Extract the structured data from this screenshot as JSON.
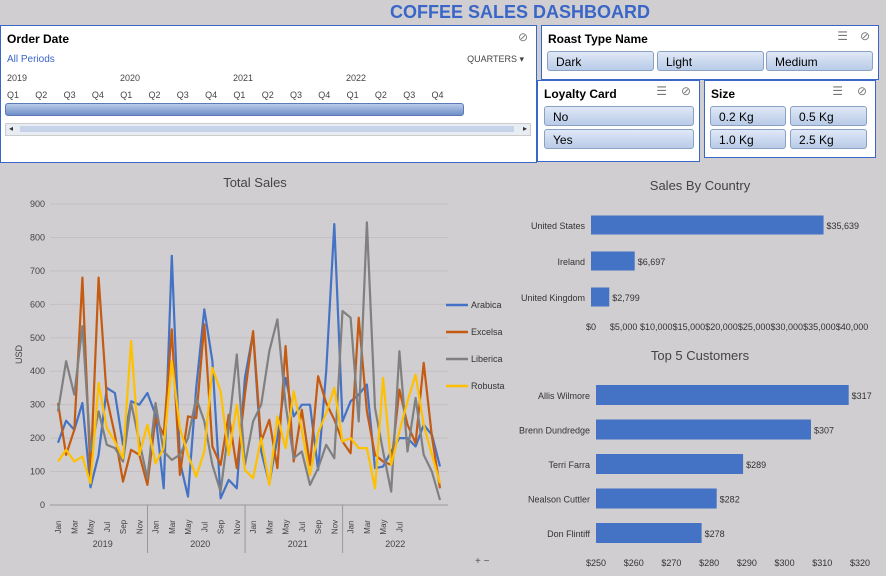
{
  "dashboard_title": "COFFEE SALES DASHBOARD",
  "order_date": {
    "header": "Order Date",
    "all_periods": "All Periods",
    "granularity": "QUARTERS",
    "years": [
      "2019",
      "2020",
      "2021",
      "2022"
    ],
    "quarters": [
      "Q1",
      "Q2",
      "Q3",
      "Q4",
      "Q1",
      "Q2",
      "Q3",
      "Q4",
      "Q1",
      "Q2",
      "Q3",
      "Q4",
      "Q1",
      "Q2",
      "Q3",
      "Q4"
    ]
  },
  "roast": {
    "header": "Roast Type Name",
    "items": [
      "Dark",
      "Light",
      "Medium"
    ]
  },
  "loyalty": {
    "header": "Loyalty Card",
    "items": [
      "No",
      "Yes"
    ]
  },
  "size": {
    "header": "Size",
    "items": [
      "0.2 Kg",
      "0.5 Kg",
      "1.0 Kg",
      "2.5 Kg"
    ]
  },
  "colors": {
    "accent": "#3a66c8",
    "arabica": "#4472c4",
    "excelsa": "#c55a11",
    "liberica": "#808080",
    "robusta": "#ffc000",
    "bar": "#4472c4"
  },
  "chart_data": [
    {
      "type": "line",
      "title": "Total Sales",
      "ylabel": "USD",
      "ylim": [
        0,
        900
      ],
      "yticks": [
        0,
        100,
        200,
        300,
        400,
        500,
        600,
        700,
        800,
        900
      ],
      "xtick_labels": [
        "Jan",
        "Mar",
        "May",
        "Jul",
        "Sep",
        "Nov",
        "Jan",
        "Mar",
        "May",
        "Jul",
        "Sep",
        "Nov",
        "Jan",
        "Mar",
        "May",
        "Jul",
        "Sep",
        "Nov",
        "Jan",
        "Mar",
        "May",
        "Jul"
      ],
      "year_labels": [
        "2019",
        "2020",
        "2021",
        "2022"
      ],
      "series": [
        {
          "name": "Arabica",
          "values": [
            186,
            252,
            225,
            305,
            53,
            150,
            350,
            335,
            180,
            310,
            300,
            335,
            270,
            50,
            745,
            130,
            25,
            350,
            585,
            430,
            20,
            75,
            50,
            380,
            515,
            160,
            65,
            200,
            380,
            265,
            300,
            300,
            105,
            400,
            840,
            250,
            310,
            330,
            360,
            110,
            115,
            160,
            200,
            200,
            175,
            240,
            210,
            115
          ]
        },
        {
          "name": "Excelsa",
          "values": [
            305,
            150,
            225,
            680,
            90,
            680,
            320,
            210,
            70,
            165,
            150,
            60,
            260,
            210,
            525,
            90,
            265,
            260,
            540,
            175,
            120,
            270,
            110,
            330,
            520,
            190,
            255,
            110,
            475,
            130,
            285,
            120,
            385,
            305,
            255,
            190,
            155,
            560,
            280,
            150,
            130,
            120,
            345,
            240,
            185,
            425,
            205,
            50
          ]
        },
        {
          "name": "Liberica",
          "values": [
            280,
            430,
            330,
            535,
            160,
            280,
            180,
            170,
            130,
            305,
            190,
            80,
            305,
            160,
            135,
            150,
            200,
            320,
            250,
            120,
            40,
            230,
            450,
            120,
            250,
            300,
            460,
            555,
            300,
            140,
            160,
            60,
            110,
            180,
            140,
            580,
            560,
            250,
            845,
            290,
            160,
            40,
            460,
            160,
            320,
            150,
            100,
            15
          ]
        },
        {
          "name": "Robusta",
          "values": [
            130,
            165,
            130,
            145,
            65,
            365,
            230,
            190,
            140,
            490,
            150,
            240,
            125,
            170,
            430,
            230,
            150,
            85,
            160,
            410,
            340,
            150,
            300,
            105,
            80,
            200,
            60,
            265,
            170,
            340,
            225,
            90,
            215,
            275,
            350,
            190,
            200,
            170,
            170,
            50,
            380,
            120,
            220,
            310,
            390,
            240,
            150,
            65
          ]
        }
      ]
    },
    {
      "type": "bar",
      "title": "Sales By Country",
      "categories": [
        "United States",
        "Ireland",
        "United Kingdom"
      ],
      "values": [
        35639,
        6697,
        2799
      ],
      "value_labels": [
        "$35,639",
        "$6,697",
        "$2,799"
      ],
      "xlim": [
        0,
        40000
      ],
      "xtick_labels": [
        "$0",
        "$5,000",
        "$10,000",
        "$15,000",
        "$20,000",
        "$25,000",
        "$30,000",
        "$35,000",
        "$40,000"
      ]
    },
    {
      "type": "bar",
      "title": "Top 5 Customers",
      "categories": [
        "Allis Wilmore",
        "Brenn Dundredge",
        "Terri Farra",
        "Nealson Cuttler",
        "Don Flintiff"
      ],
      "values": [
        317,
        307,
        289,
        282,
        278
      ],
      "value_labels": [
        "$317",
        "$307",
        "$289",
        "$282",
        "$278"
      ],
      "xlim": [
        250,
        320
      ],
      "xtick_labels": [
        "$250",
        "$260",
        "$270",
        "$280",
        "$290",
        "$300",
        "$310",
        "$320"
      ]
    }
  ]
}
